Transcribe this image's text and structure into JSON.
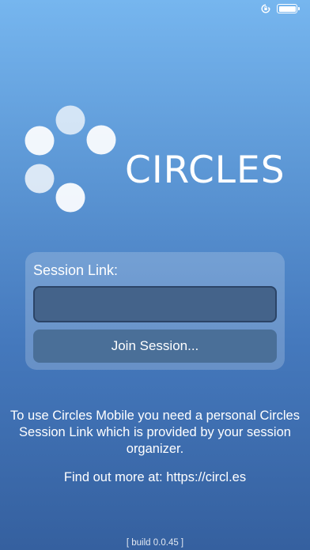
{
  "status_bar": {
    "icons": [
      "orientation-lock-icon",
      "battery-icon"
    ]
  },
  "logo": {
    "wordmark": "CIRCLES",
    "icon": "circles-logo-icon"
  },
  "session": {
    "label": "Session Link:",
    "input_value": "",
    "input_placeholder": "",
    "join_label": "Join Session..."
  },
  "info": {
    "message": "To use Circles Mobile you need a personal Circles Session Link which is provided by your session organizer.",
    "find_out_more": "Find out more at: https://circl.es"
  },
  "build": {
    "label": "[ build 0.0.45 ]"
  },
  "colors": {
    "background_top": "#76b6ef",
    "background_bottom": "#35609f",
    "input_bg": "#44638a",
    "button_bg": "#4a6f98",
    "text": "#ffffff"
  }
}
